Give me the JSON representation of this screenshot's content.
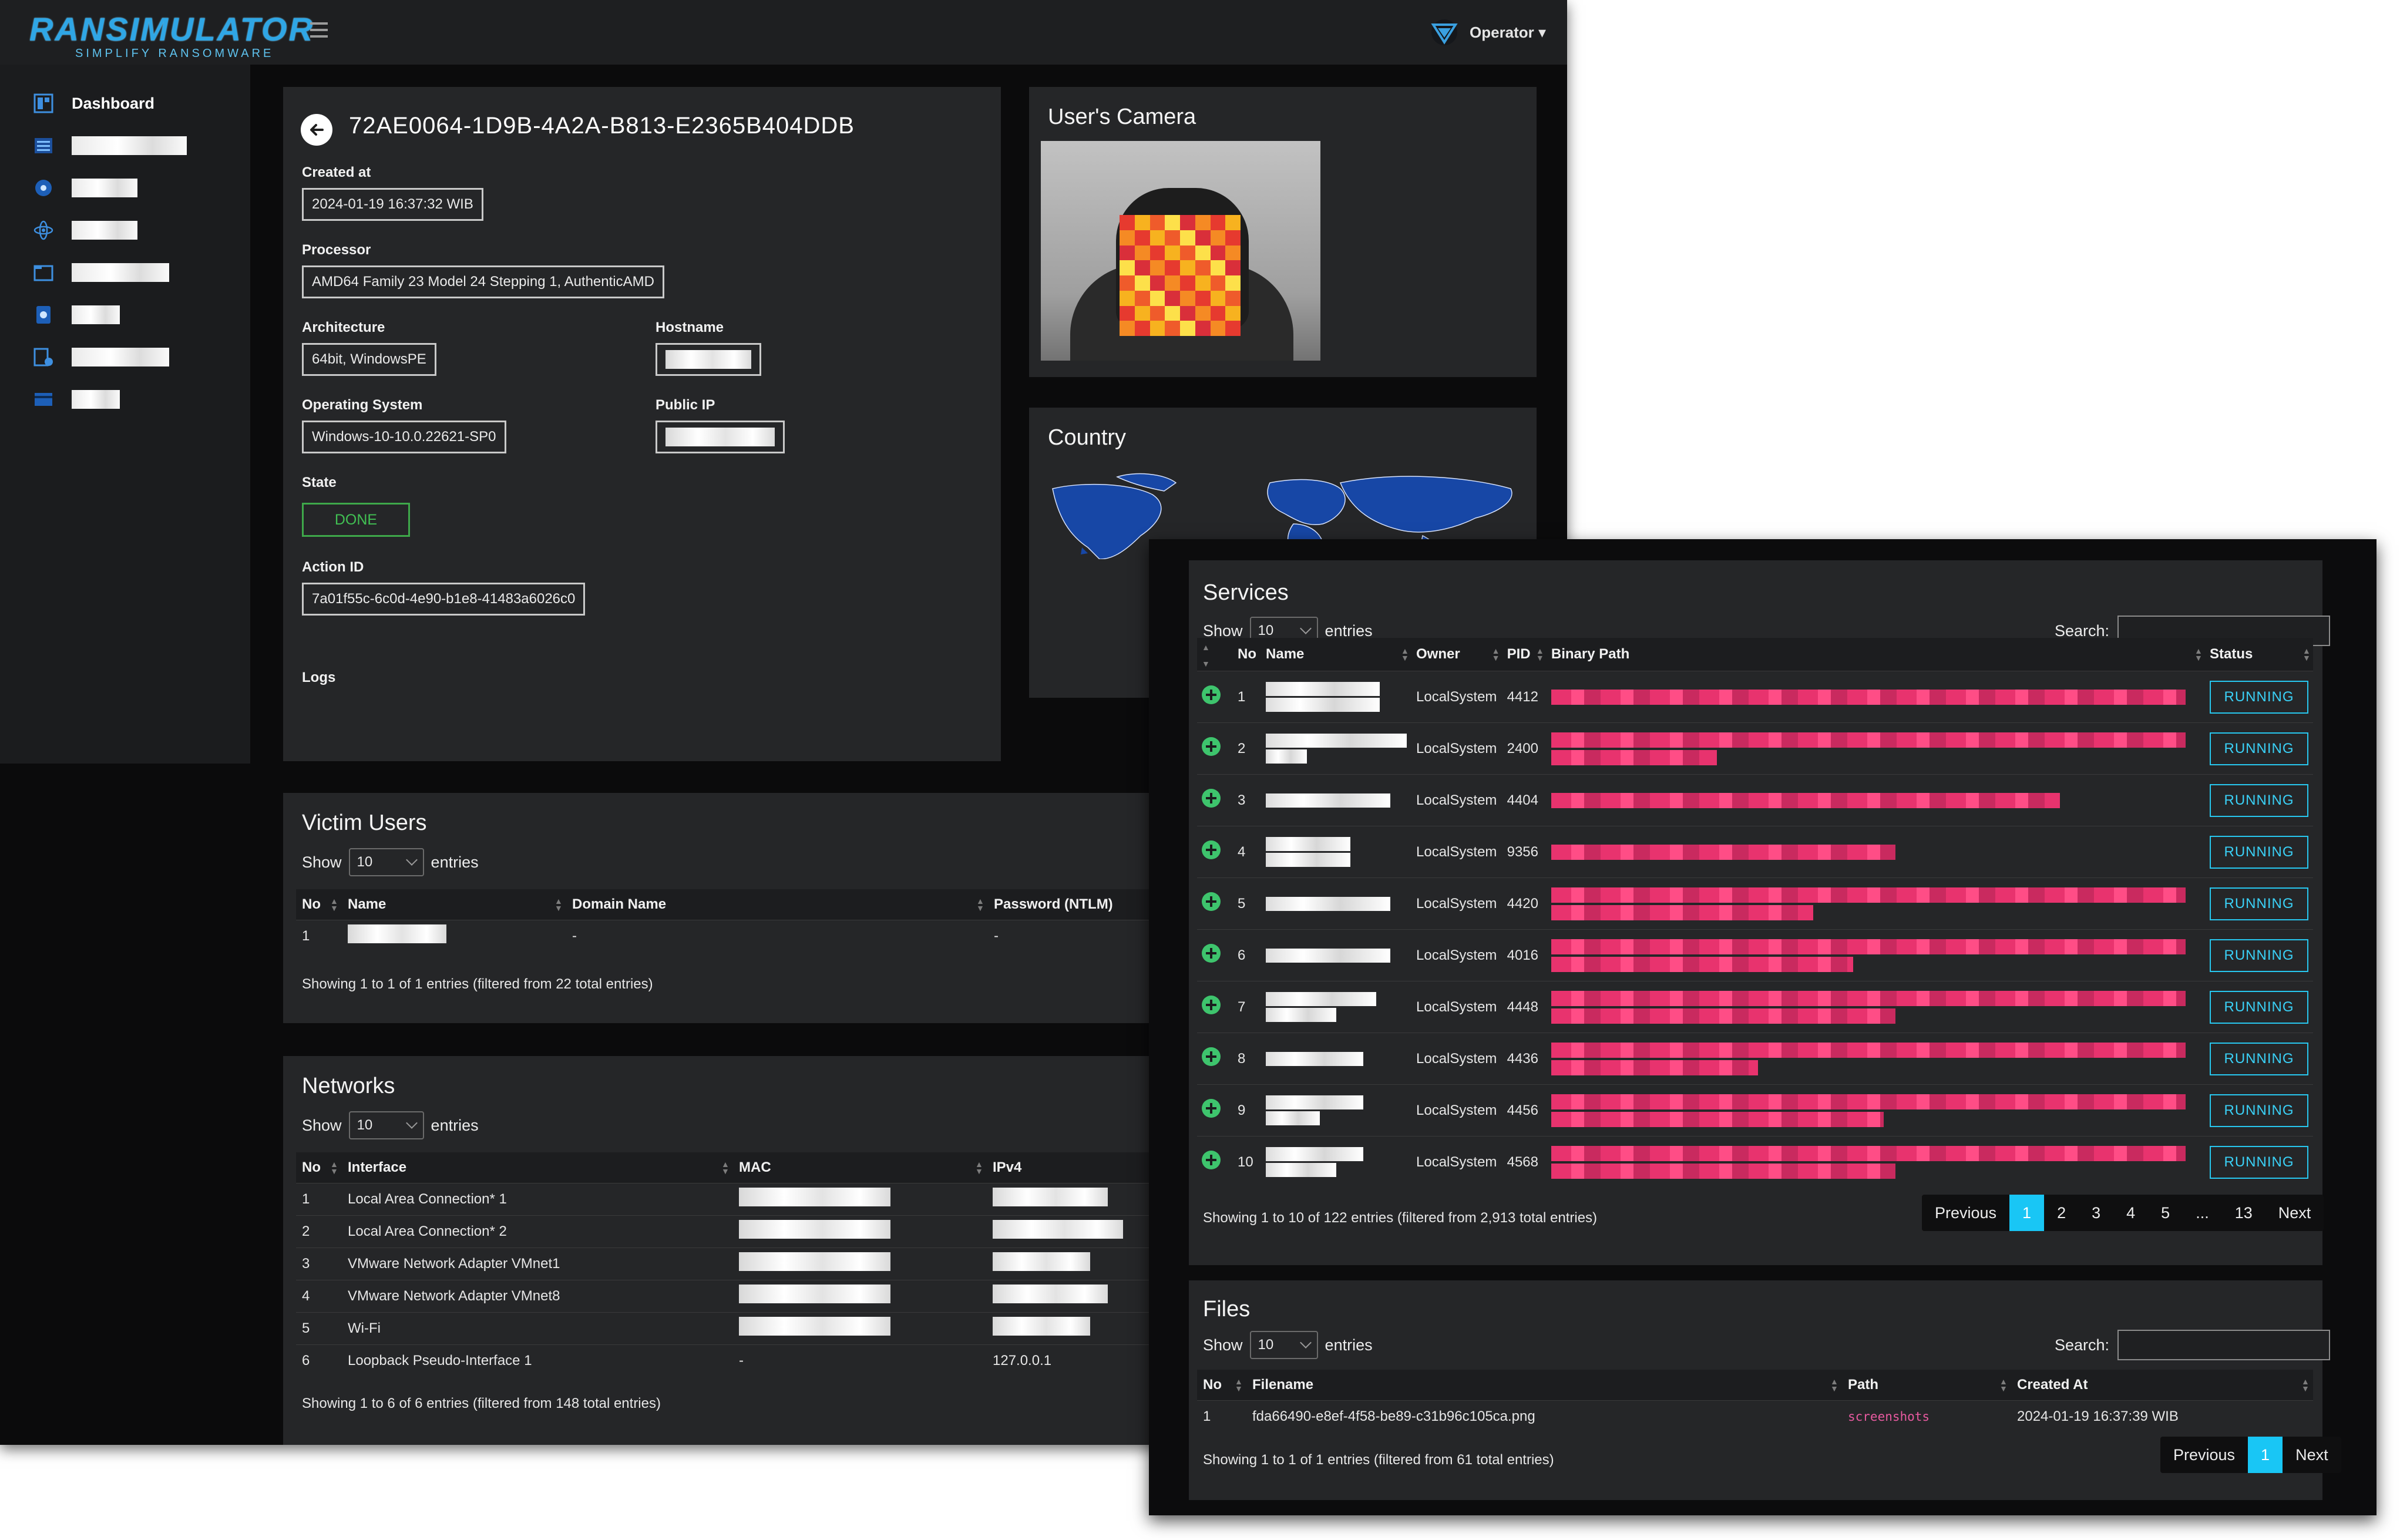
{
  "app": {
    "brand": "RANSIMULATOR",
    "tagline": "SIMPLIFY RANSOMWARE",
    "user_menu": "Operator ▾"
  },
  "sidebar": {
    "items": [
      {
        "label": "Dashboard",
        "icon": "dashboard-icon"
      },
      {
        "label": "",
        "icon": "list-icon",
        "redacted": true
      },
      {
        "label": "",
        "icon": "biohazard-icon",
        "redacted": true
      },
      {
        "label": "",
        "icon": "atom-icon",
        "redacted": true
      },
      {
        "label": "",
        "icon": "folder-icon",
        "redacted": true
      },
      {
        "label": "",
        "icon": "device-icon",
        "redacted": true
      },
      {
        "label": "",
        "icon": "table-icon",
        "redacted": true
      },
      {
        "label": "",
        "icon": "card-icon",
        "redacted": true
      }
    ]
  },
  "detail": {
    "id": "72AE0064-1D9B-4A2A-B813-E2365B404DDB",
    "created_at_label": "Created at",
    "created_at": "2024-01-19 16:37:32 WIB",
    "processor_label": "Processor",
    "processor": "AMD64 Family 23 Model 24 Stepping 1, AuthenticAMD",
    "architecture_label": "Architecture",
    "architecture": "64bit, WindowsPE",
    "hostname_label": "Hostname",
    "os_label": "Operating System",
    "os": "Windows-10-10.0.22621-SP0",
    "public_ip_label": "Public IP",
    "state_label": "State",
    "state": "DONE",
    "action_id_label": "Action ID",
    "action_id": "7a01f55c-6c0d-4e90-b1e8-41483a6026c0",
    "logs_label": "Logs"
  },
  "camera": {
    "title": "User's Camera"
  },
  "country": {
    "title": "Country"
  },
  "victim_users": {
    "title": "Victim Users",
    "show": "Show",
    "entries_value": "10",
    "entries": "entries",
    "columns": [
      "No",
      "Name",
      "Domain Name",
      "Password (NTLM)"
    ],
    "rows": [
      {
        "no": "1",
        "domain": "-",
        "password": "-"
      }
    ],
    "info": "Showing 1 to 1 of 1 entries (filtered from 22 total entries)"
  },
  "networks": {
    "title": "Networks",
    "show": "Show",
    "entries_value": "10",
    "entries": "entries",
    "columns": [
      "No",
      "Interface",
      "MAC",
      "IPv4"
    ],
    "rows": [
      {
        "no": "1",
        "interface": "Local Area Connection* 1",
        "mac": "",
        "ipv4": ""
      },
      {
        "no": "2",
        "interface": "Local Area Connection* 2",
        "mac": "",
        "ipv4": ""
      },
      {
        "no": "3",
        "interface": "VMware Network Adapter VMnet1",
        "mac": "",
        "ipv4": ""
      },
      {
        "no": "4",
        "interface": "VMware Network Adapter VMnet8",
        "mac": "",
        "ipv4": ""
      },
      {
        "no": "5",
        "interface": "Wi-Fi",
        "mac": "",
        "ipv4": ""
      },
      {
        "no": "6",
        "interface": "Loopback Pseudo-Interface 1",
        "mac": "-",
        "ipv4": "127.0.0.1"
      }
    ],
    "info": "Showing 1 to 6 of 6 entries (filtered from 148 total entries)"
  },
  "services": {
    "title": "Services",
    "show": "Show",
    "entries_value": "10",
    "entries": "entries",
    "search_label": "Search:",
    "columns": [
      "No",
      "Name",
      "Owner",
      "PID",
      "Binary Path",
      "Status"
    ],
    "rows": [
      {
        "no": "1",
        "owner": "LocalSystem",
        "pid": "4412",
        "status": "RUNNING"
      },
      {
        "no": "2",
        "owner": "LocalSystem",
        "pid": "2400",
        "status": "RUNNING"
      },
      {
        "no": "3",
        "owner": "LocalSystem",
        "pid": "4404",
        "status": "RUNNING"
      },
      {
        "no": "4",
        "owner": "LocalSystem",
        "pid": "9356",
        "status": "RUNNING"
      },
      {
        "no": "5",
        "owner": "LocalSystem",
        "pid": "4420",
        "status": "RUNNING"
      },
      {
        "no": "6",
        "owner": "LocalSystem",
        "pid": "4016",
        "status": "RUNNING"
      },
      {
        "no": "7",
        "owner": "LocalSystem",
        "pid": "4448",
        "status": "RUNNING"
      },
      {
        "no": "8",
        "owner": "LocalSystem",
        "pid": "4436",
        "status": "RUNNING"
      },
      {
        "no": "9",
        "owner": "LocalSystem",
        "pid": "4456",
        "status": "RUNNING"
      },
      {
        "no": "10",
        "owner": "LocalSystem",
        "pid": "4568",
        "status": "RUNNING"
      }
    ],
    "info": "Showing 1 to 10 of 122 entries (filtered from 2,913 total entries)",
    "pagination": [
      "Previous",
      "1",
      "2",
      "3",
      "4",
      "5",
      "...",
      "13",
      "Next"
    ],
    "active_page": "1"
  },
  "files": {
    "title": "Files",
    "show": "Show",
    "entries_value": "10",
    "entries": "entries",
    "search_label": "Search:",
    "columns": [
      "No",
      "Filename",
      "Path",
      "Created At"
    ],
    "rows": [
      {
        "no": "1",
        "filename": "fda66490-e8ef-4f58-be89-c31b96c105ca.png",
        "path": "screenshots",
        "created_at": "2024-01-19 16:37:39 WIB"
      }
    ],
    "info": "Showing 1 to 1 of 1 entries (filtered from 61 total entries)",
    "pagination": [
      "Previous",
      "1",
      "Next"
    ],
    "active_page": "1"
  },
  "colors": {
    "accent": "#19c6f5",
    "running": "#27c7ef",
    "done": "#3ea84a",
    "status_ok": "#3ec46d",
    "path_link": "#e85aa0"
  }
}
